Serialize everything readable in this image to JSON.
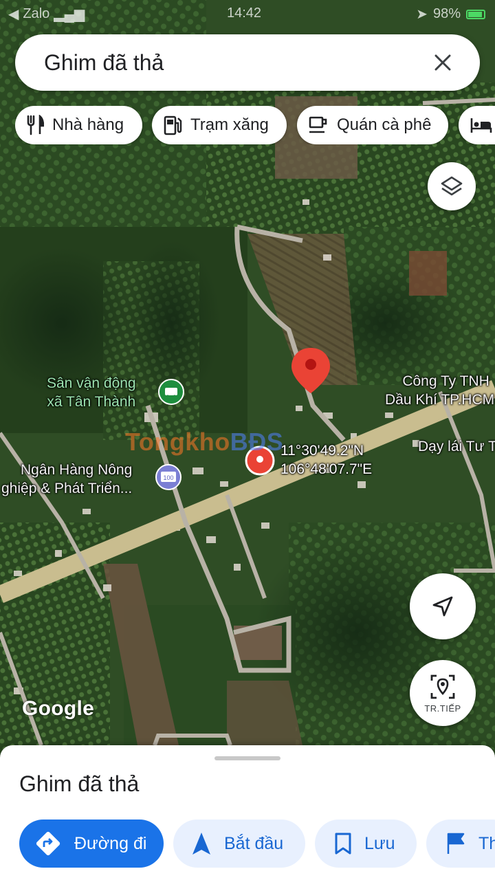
{
  "status_bar": {
    "carrier": "Zalo",
    "time": "14:42",
    "battery": "98%"
  },
  "search": {
    "value": "Ghim đã thả",
    "close_icon": "close-icon"
  },
  "chips": [
    {
      "label": "Nhà hàng",
      "icon": "restaurant-icon"
    },
    {
      "label": "Trạm xăng",
      "icon": "gas-station-icon"
    },
    {
      "label": "Quán cà phê",
      "icon": "coffee-icon"
    },
    {
      "label": "",
      "icon": "hotel-icon"
    }
  ],
  "map": {
    "labels": {
      "stadium_line1": "Sân vận động",
      "stadium_line2": "xã Tân Thành",
      "bank_line1": "Ngân Hàng Nông",
      "bank_line2": "ghiệp & Phát Triển...",
      "company_line1": "Công Ty TNH",
      "company_line2": "Dầu Khí TP.HCM",
      "driving_school": "Dạy lái Tư T",
      "coord_lat": "11°30'49.2\"N",
      "coord_lng": "106°48'07.7\"E"
    },
    "watermark_a": "Tongkho",
    "watermark_b": "BĐS",
    "google_logo": "Google",
    "live_view_label": "TR.TIẾP"
  },
  "sheet": {
    "title": "Ghim đã thả",
    "actions": [
      {
        "label": "Đường đi",
        "icon": "directions-icon"
      },
      {
        "label": "Bắt đầu",
        "icon": "navigation-arrow-icon"
      },
      {
        "label": "Lưu",
        "icon": "bookmark-icon"
      },
      {
        "label": "Th",
        "icon": "flag-icon"
      }
    ]
  },
  "colors": {
    "accent": "#1a73e8",
    "pin": "#ea4335",
    "action_secondary_bg": "#e8f0fe",
    "stadium_label": "#9be3b0",
    "road": "#c9bd8f"
  }
}
